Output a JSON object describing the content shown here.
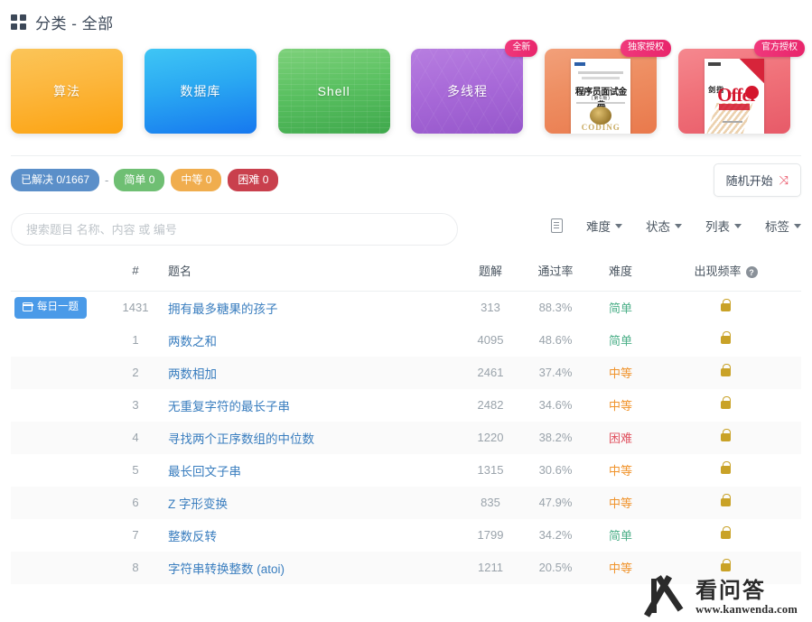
{
  "header": {
    "icon": "grid-icon",
    "title": "分类 - 全部"
  },
  "cards": [
    {
      "label": "算法",
      "type": "plain",
      "theme": "c-algo",
      "badge": null
    },
    {
      "label": "数据库",
      "type": "plain",
      "theme": "c-db",
      "badge": null
    },
    {
      "label": "Shell",
      "type": "plain",
      "theme": "c-shell",
      "badge": null
    },
    {
      "label": "多线程",
      "type": "plain",
      "theme": "c-mt",
      "badge": null
    },
    {
      "label": "",
      "type": "book1",
      "theme": "c-book1",
      "badge": "全新"
    },
    {
      "label": "",
      "type": "book2",
      "theme": "c-book2",
      "badge": "独家授权"
    }
  ],
  "card_badges": {
    "new": "全新",
    "exclusive": "独家授权",
    "official": "官方授权"
  },
  "book1": {
    "title": "程序员面试金典",
    "edition": "(第6版)",
    "footer": "CODING"
  },
  "book2": {
    "prefix": "剑指",
    "title": "Offer"
  },
  "stats": {
    "solved_label": "已解决 0/1667",
    "separator": "-",
    "easy_label": "简单 0",
    "medium_label": "中等 0",
    "hard_label": "困难 0"
  },
  "random_button": {
    "label": "随机开始",
    "icon": "shuffle-icon"
  },
  "search": {
    "placeholder": "搜索题目 名称、内容 或 编号",
    "value": ""
  },
  "filters": [
    {
      "name": "list-view-icon",
      "label": ""
    },
    {
      "name": "difficulty",
      "label": "难度"
    },
    {
      "name": "status",
      "label": "状态"
    },
    {
      "name": "list",
      "label": "列表"
    },
    {
      "name": "tags",
      "label": "标签"
    }
  ],
  "table": {
    "columns": {
      "tag": "",
      "num": "#",
      "name": "题名",
      "solutions": "题解",
      "rate": "通过率",
      "difficulty": "难度",
      "frequency": "出现频率",
      "frequency_help": "?"
    },
    "rows": [
      {
        "tag": "每日一题",
        "num": "1431",
        "name": "拥有最多糖果的孩子",
        "solutions": "313",
        "rate": "88.3%",
        "difficulty": "简单",
        "diff_class": "d-easy",
        "locked": true
      },
      {
        "tag": "",
        "num": "1",
        "name": "两数之和",
        "solutions": "4095",
        "rate": "48.6%",
        "difficulty": "简单",
        "diff_class": "d-easy",
        "locked": true
      },
      {
        "tag": "",
        "num": "2",
        "name": "两数相加",
        "solutions": "2461",
        "rate": "37.4%",
        "difficulty": "中等",
        "diff_class": "d-med",
        "locked": true
      },
      {
        "tag": "",
        "num": "3",
        "name": "无重复字符的最长子串",
        "solutions": "2482",
        "rate": "34.6%",
        "difficulty": "中等",
        "diff_class": "d-med",
        "locked": true
      },
      {
        "tag": "",
        "num": "4",
        "name": "寻找两个正序数组的中位数",
        "solutions": "1220",
        "rate": "38.2%",
        "difficulty": "困难",
        "diff_class": "d-hard",
        "locked": true
      },
      {
        "tag": "",
        "num": "5",
        "name": "最长回文子串",
        "solutions": "1315",
        "rate": "30.6%",
        "difficulty": "中等",
        "diff_class": "d-med",
        "locked": true
      },
      {
        "tag": "",
        "num": "6",
        "name": "Z 字形变换",
        "solutions": "835",
        "rate": "47.9%",
        "difficulty": "中等",
        "diff_class": "d-med",
        "locked": true
      },
      {
        "tag": "",
        "num": "7",
        "name": "整数反转",
        "solutions": "1799",
        "rate": "34.2%",
        "difficulty": "简单",
        "diff_class": "d-easy",
        "locked": true
      },
      {
        "tag": "",
        "num": "8",
        "name": "字符串转换整数 (atoi)",
        "solutions": "1211",
        "rate": "20.5%",
        "difficulty": "中等",
        "diff_class": "d-med",
        "locked": true
      }
    ]
  },
  "watermark": {
    "name": "看问答",
    "url": "www.kanwenda.com"
  },
  "colors": {
    "accent_blue": "#4a9ae8",
    "easy": "#4caf88",
    "medium": "#f0932b",
    "hard": "#e05260",
    "badge_pink": "#e8256b",
    "link": "#3a7ebf"
  }
}
